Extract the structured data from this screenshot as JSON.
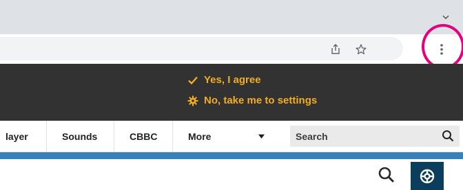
{
  "browser": {
    "toolbar_icons": [
      "share-icon",
      "star-icon",
      "three-dot-menu-icon"
    ],
    "highlight_color": "#e5007e"
  },
  "cookie_banner": {
    "agree_label": "Yes, I agree",
    "settings_label": "No, take me to settings",
    "accent_color": "#f3ad1e",
    "background": "#323232"
  },
  "nav": {
    "items": [
      {
        "label": "layer"
      },
      {
        "label": "Sounds"
      },
      {
        "label": "CBBC"
      },
      {
        "label": "More"
      }
    ],
    "search_label": "Search"
  },
  "colors": {
    "blue_strip": "#3a80b8",
    "account_bg": "#0b3d5c"
  }
}
